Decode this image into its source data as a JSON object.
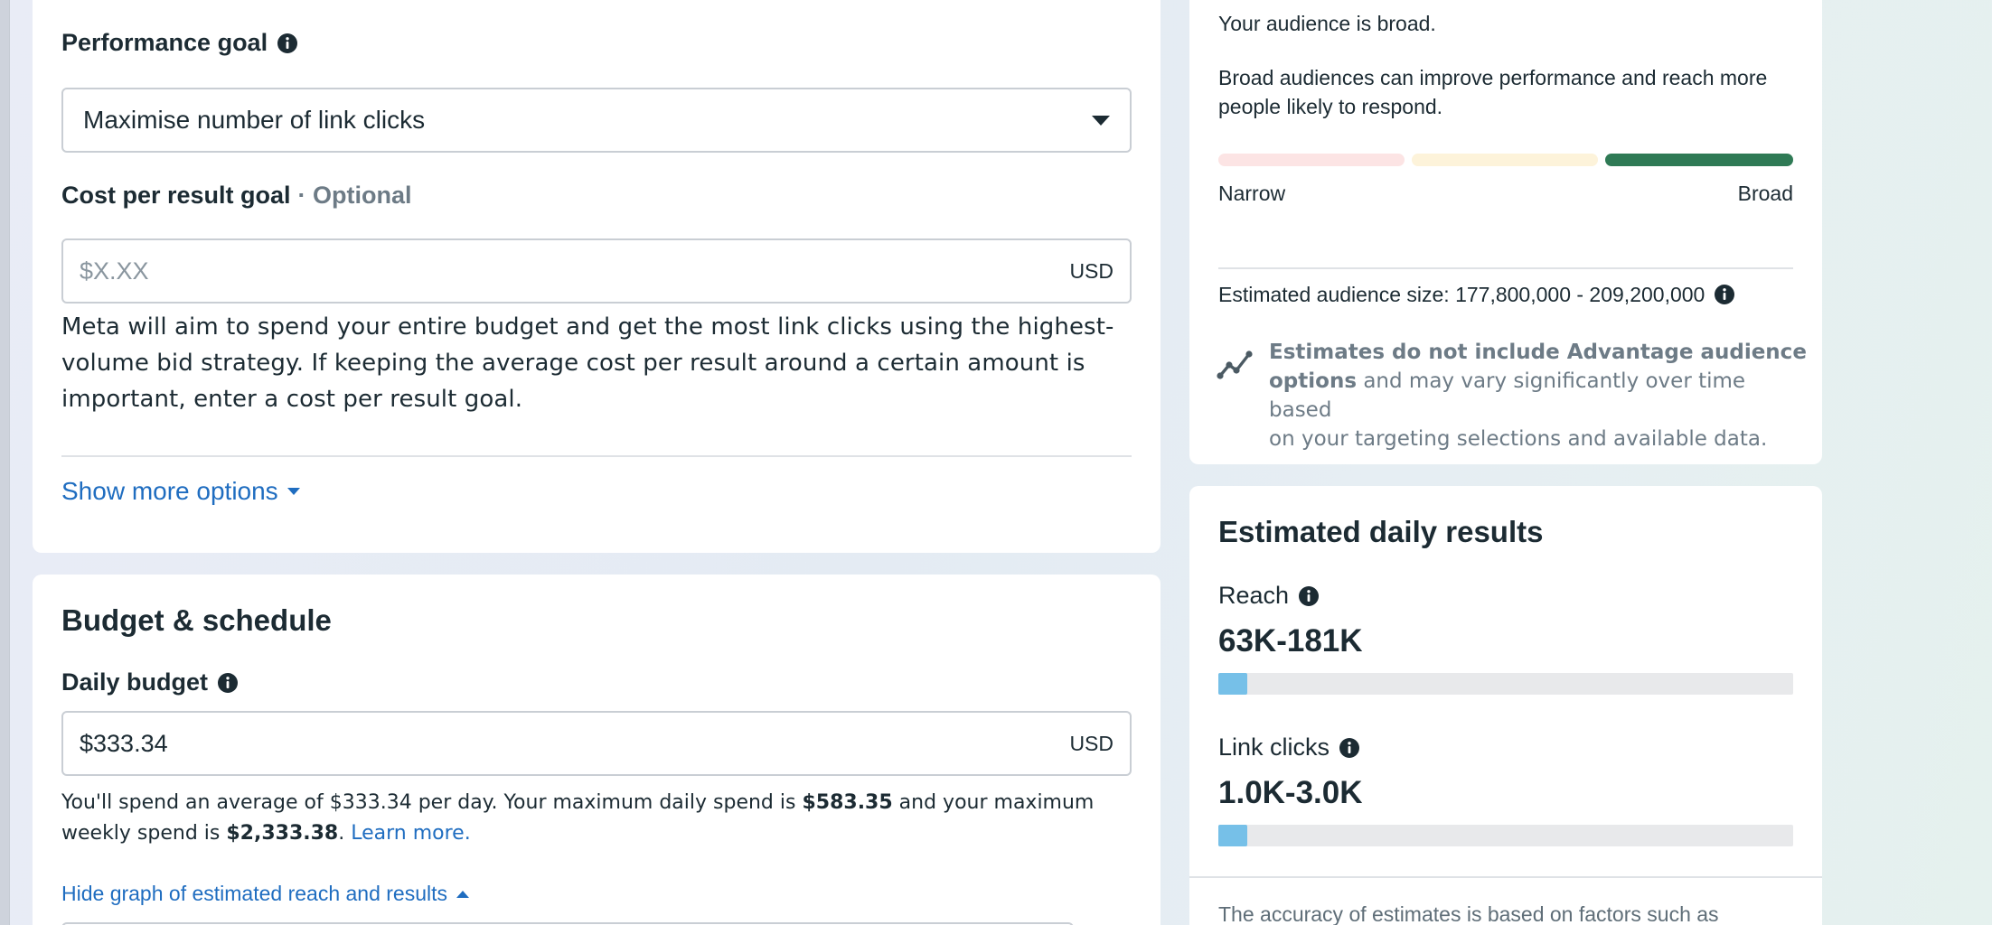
{
  "colors": {
    "accent_link": "#1f6dc0",
    "meter_narrow": "#fce4e4",
    "meter_mid": "#fdf3da",
    "meter_broad": "#2f7a55",
    "result_bar": "#76c0e8"
  },
  "performance": {
    "label": "Performance goal",
    "info_icon": "info-icon",
    "selected": "Maximise number of link clicks",
    "cost_label": "Cost per result goal",
    "cost_optional": "· Optional",
    "cost_placeholder": "$X.XX",
    "cost_unit": "USD",
    "help_line1": "Meta will aim to spend your entire budget and get the most link clicks using the highest-",
    "help_line2": "volume bid strategy. If keeping the average cost per result around a certain amount is",
    "help_line3": "important, enter a cost per result goal.",
    "show_more": "Show more options"
  },
  "budget": {
    "title": "Budget & schedule",
    "daily_label": "Daily budget",
    "daily_value": "$333.34",
    "daily_unit": "USD",
    "spend_pre": "You'll spend an average of $333.34 per day. Your maximum daily spend is ",
    "spend_max_daily": "$583.35",
    "spend_mid": " and your maximum",
    "spend_pre2": "weekly spend is ",
    "spend_max_weekly": "$2,333.38",
    "spend_dot": ". ",
    "learn_more": "Learn more.",
    "hide_graph": "Hide graph of estimated reach and results"
  },
  "audience": {
    "status": "Your audience is broad.",
    "desc_line1": "Broad audiences can improve performance and reach more",
    "desc_line2": "people likely to respond.",
    "meter_level": "broad",
    "narrow_label": "Narrow",
    "broad_label": "Broad",
    "size_text": "Estimated audience size: 177,800,000 - 209,200,000",
    "estimate_icon": "trend-icon",
    "note_bold1": "Estimates do not include Advantage audience",
    "note_bold2": "options",
    "note_rest1": " and may vary significantly over time based",
    "note_line3": "on your targeting selections and available data."
  },
  "results": {
    "title": "Estimated daily results",
    "metrics": [
      {
        "label": "Reach",
        "value": "63K-181K",
        "fill_fraction": 0.05
      },
      {
        "label": "Link clicks",
        "value": "1.0K-3.0K",
        "fill_fraction": 0.05
      }
    ],
    "footer": "The accuracy of estimates is based on factors such as"
  }
}
